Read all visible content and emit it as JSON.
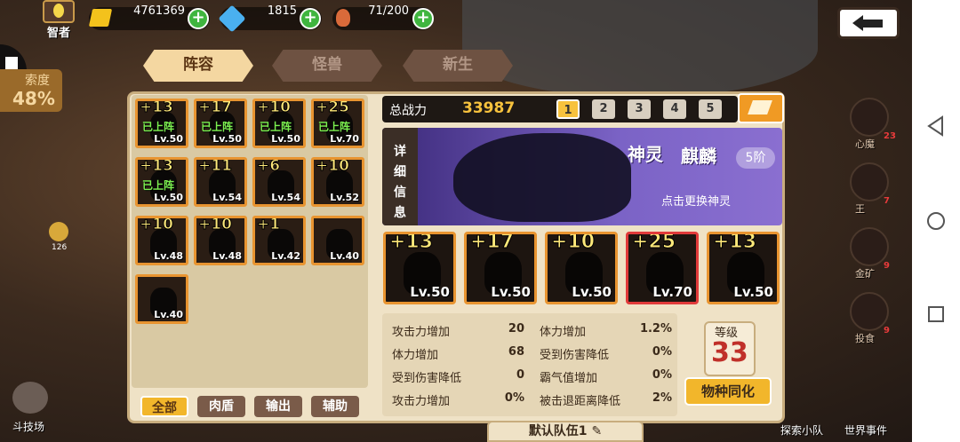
{
  "player": {
    "title": "智者"
  },
  "resources": {
    "gold": "4761369",
    "gems": "1815",
    "stamina": "71/200"
  },
  "tabs": [
    {
      "label": "阵容"
    },
    {
      "label": "怪兽"
    },
    {
      "label": "新生"
    }
  ],
  "left_hud": {
    "progress_label": "索度",
    "progress_value": "48%",
    "arena_label": "斗技场",
    "small_num": "126"
  },
  "roster": [
    {
      "plus": "+13",
      "lv": "Lv.50",
      "status": "已上阵"
    },
    {
      "plus": "+17",
      "lv": "Lv.50",
      "status": "已上阵"
    },
    {
      "plus": "+10",
      "lv": "Lv.50",
      "status": "已上阵"
    },
    {
      "plus": "+25",
      "lv": "Lv.70",
      "status": "已上阵"
    },
    {
      "plus": "+13",
      "lv": "Lv.50",
      "status": "已上阵"
    },
    {
      "plus": "+11",
      "lv": "Lv.54",
      "status": ""
    },
    {
      "plus": "+6",
      "lv": "Lv.54",
      "status": ""
    },
    {
      "plus": "+10",
      "lv": "Lv.52",
      "status": ""
    },
    {
      "plus": "+10",
      "lv": "Lv.48",
      "status": ""
    },
    {
      "plus": "+10",
      "lv": "Lv.48",
      "status": ""
    },
    {
      "plus": "+1",
      "lv": "Lv.42",
      "status": ""
    },
    {
      "plus": "",
      "lv": "Lv.40",
      "status": ""
    },
    {
      "plus": "",
      "lv": "Lv.40",
      "status": ""
    }
  ],
  "filters": [
    {
      "label": "全部"
    },
    {
      "label": "肉盾"
    },
    {
      "label": "输出"
    },
    {
      "label": "辅助"
    }
  ],
  "power": {
    "label": "总战力",
    "value": "33987"
  },
  "pages": [
    "1",
    "2",
    "3",
    "4",
    "5"
  ],
  "spirit": {
    "detail": "详细信息",
    "type": "神灵",
    "name": "麒麟",
    "rank": "5阶",
    "change": "点击更换神灵"
  },
  "team": [
    {
      "plus": "+13",
      "lv": "Lv.50"
    },
    {
      "plus": "+17",
      "lv": "Lv.50"
    },
    {
      "plus": "+10",
      "lv": "Lv.50"
    },
    {
      "plus": "+25",
      "lv": "Lv.70"
    },
    {
      "plus": "+13",
      "lv": "Lv.50"
    }
  ],
  "stats_left": [
    {
      "label": "攻击力增加",
      "value": "20"
    },
    {
      "label": "体力增加",
      "value": "68"
    },
    {
      "label": "受到伤害降低",
      "value": "0"
    },
    {
      "label": "攻击力增加",
      "value": "0%"
    }
  ],
  "stats_right": [
    {
      "label": "体力增加",
      "value": "1.2%"
    },
    {
      "label": "受到伤害降低",
      "value": "0%"
    },
    {
      "label": "霸气值增加",
      "value": "0%"
    },
    {
      "label": "被击退距离降低",
      "value": "2%"
    }
  ],
  "level": {
    "label": "等级",
    "value": "33"
  },
  "sync_button": "物种同化",
  "team_name": "默认队伍1",
  "right_side": [
    {
      "label": "心魔",
      "count": "23"
    },
    {
      "label": "王",
      "count": "7"
    },
    {
      "label": "金矿",
      "count": "9"
    },
    {
      "label": "投食",
      "count": "9"
    }
  ],
  "bottom_right": [
    {
      "label": "探索小队"
    },
    {
      "label": "世界事件"
    }
  ],
  "colors": {
    "accent": "#e89430",
    "gold": "#f7c23d",
    "panel": "#efe2c6"
  }
}
